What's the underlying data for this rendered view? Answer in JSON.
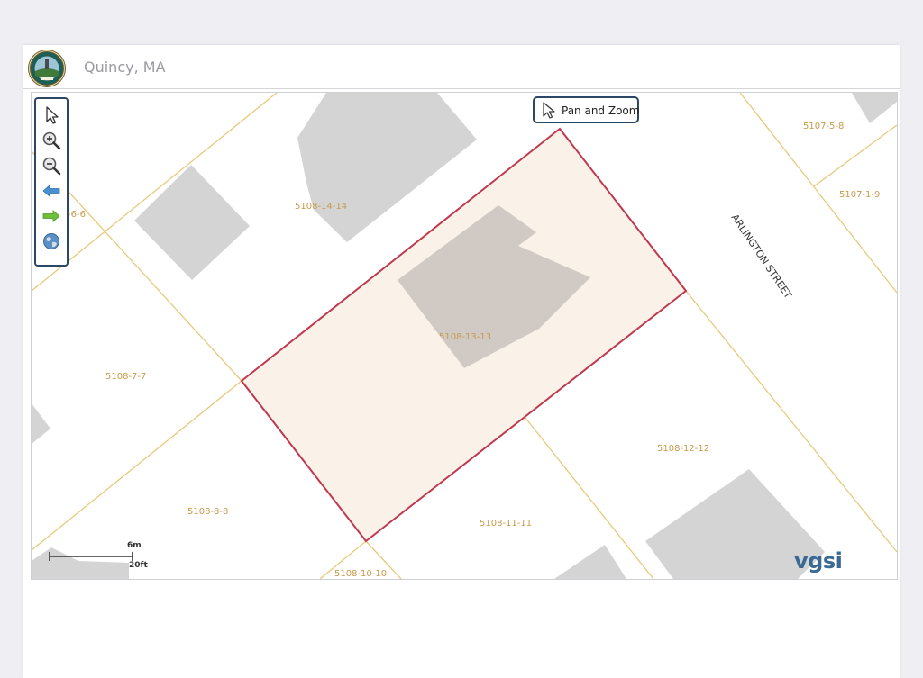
{
  "header": {
    "town": "Quincy, MA",
    "seal_icon": "city-seal-icon"
  },
  "toolbar": {
    "tools": [
      {
        "name": "select-arrow-icon"
      },
      {
        "name": "zoom-in-icon"
      },
      {
        "name": "zoom-out-icon"
      },
      {
        "name": "back-arrow-icon"
      },
      {
        "name": "forward-arrow-icon"
      },
      {
        "name": "globe-icon"
      }
    ]
  },
  "mode": {
    "label": "Pan and Zoom"
  },
  "parcels": {
    "subject": "5108-13-13",
    "labels": [
      "5107-5-8",
      "5107-1-9",
      "-6-6",
      "5108-14-14",
      "5108-7-7",
      "5108-12-12",
      "5108-8-8",
      "5108-11-11",
      "5108-10-10"
    ]
  },
  "street": "ARLINGTON STREET",
  "scale": {
    "metric": "6m",
    "imperial": "20ft"
  },
  "brand": "vgsi",
  "colors": {
    "parcel_line": "#e8c97a",
    "building": "#d4d4d4",
    "selected_outline": "#c0384d",
    "selected_fill": "#f9efe7",
    "toolbar_border": "#2c4766"
  }
}
